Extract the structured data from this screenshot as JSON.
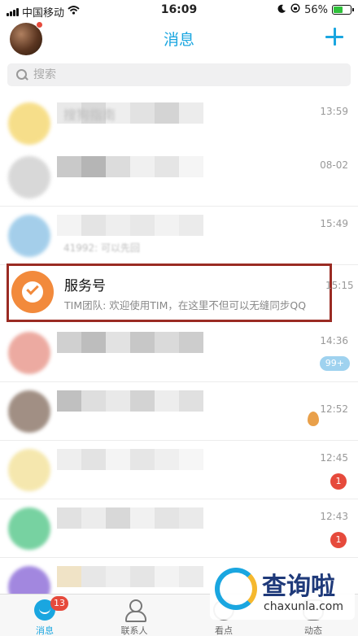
{
  "status_bar": {
    "carrier": "中国移动",
    "time": "16:09",
    "battery": "56%",
    "battery_level": 0.56
  },
  "nav": {
    "title": "消息"
  },
  "search": {
    "placeholder": "搜索"
  },
  "chats": [
    {
      "time": "13:59",
      "title_blurred": "搜狗指南",
      "avatar_color": "#f5d76e"
    },
    {
      "time": "08-02",
      "avatar_color": "#bbbbbb"
    },
    {
      "time": "15:49",
      "preview_blurred": "41992: 可以先回",
      "avatar_color": "#8ec3e6"
    },
    {
      "time": "14:36",
      "badge": "99+",
      "avatar_color": "#e8968a"
    },
    {
      "time": "12:52",
      "avatar_color": "#8a7466"
    },
    {
      "time": "12:45",
      "badge": "1",
      "avatar_color": "#f3e29a"
    },
    {
      "time": "12:43",
      "badge": "1",
      "avatar_color": "#56c78a"
    },
    {
      "time": "",
      "avatar_color": "#8b6ad8"
    }
  ],
  "highlighted_chat": {
    "name": "服务号",
    "preview": "TIM团队: 欢迎使用TIM，在这里不但可以无缝同步QQ",
    "time": "15:15",
    "icon": "verified-check-icon",
    "accent": "#f28a3c",
    "highlight_color": "#9a2b23"
  },
  "tabs": [
    {
      "label": "消息",
      "badge": "13",
      "active": true
    },
    {
      "label": "联系人"
    },
    {
      "label": "看点"
    },
    {
      "label": "动态"
    }
  ],
  "watermark": {
    "text": "查询啦",
    "sub": "chaxunla.com"
  },
  "colors": {
    "accent": "#1aa6e0",
    "badge_red": "#e64a3c"
  }
}
